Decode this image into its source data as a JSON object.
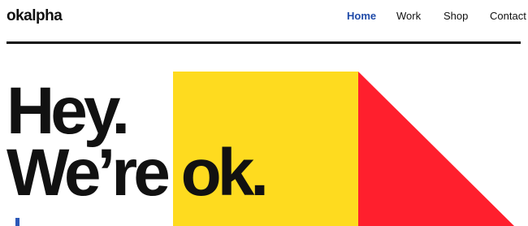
{
  "brand": {
    "logo_text": "okalpha"
  },
  "nav": {
    "items": [
      {
        "label": "Home",
        "active": true
      },
      {
        "label": "Work",
        "active": false
      },
      {
        "label": "Shop",
        "active": false
      },
      {
        "label": "Contact",
        "active": false
      }
    ]
  },
  "hero": {
    "line1": "Hey.",
    "line2": "We’re ok."
  },
  "colors": {
    "text": "#111111",
    "nav_active": "#1f4aa8",
    "yellow": "#fedb1f",
    "red": "#ff1f2d",
    "accent_blue": "#2c58b8",
    "background": "#ffffff"
  }
}
